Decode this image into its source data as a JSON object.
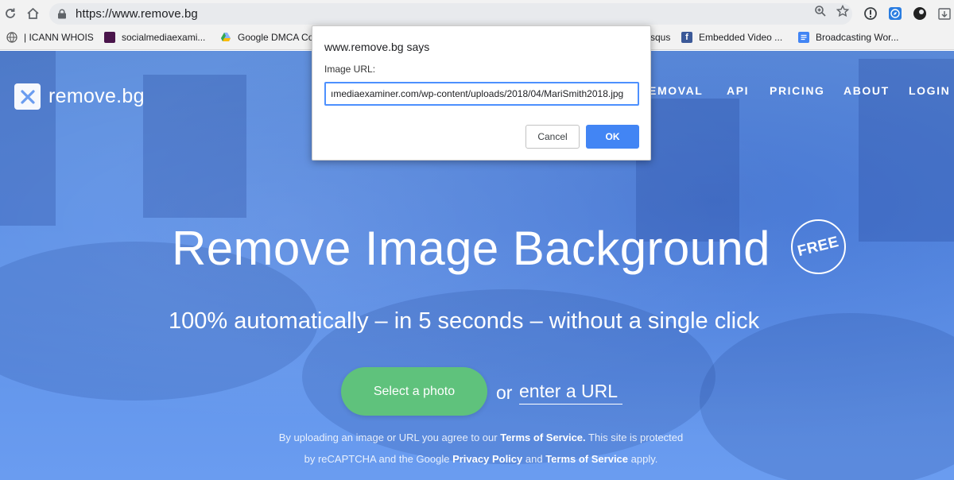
{
  "browser": {
    "url": "https://www.remove.bg",
    "bookmarks": [
      {
        "label": "| ICANN WHOIS",
        "icon": "globe-icon"
      },
      {
        "label": "socialmediaexami...",
        "icon": "slack-icon"
      },
      {
        "label": "Google DMCA Co",
        "icon": "drive-icon"
      },
      {
        "label": "squs",
        "icon": "disqus-icon"
      },
      {
        "label": "Embedded Video ...",
        "icon": "facebook-icon"
      },
      {
        "label": "Broadcasting Wor...",
        "icon": "docs-icon"
      }
    ]
  },
  "site": {
    "logo_text": "remove.bg",
    "nav": [
      "EMOVAL",
      "API",
      "PRICING",
      "ABOUT",
      "LOGIN"
    ],
    "hero_title": "Remove Image Background",
    "free_badge": "FREE",
    "subtitle": "100% automatically – in 5 seconds – without a single click",
    "select_button": "Select a photo",
    "or_text": "or",
    "url_link": "enter a URL",
    "legal": {
      "line1_pre": "By uploading an image or URL you agree to our",
      "terms": "Terms of Service.",
      "line1_post": "This site is protected",
      "line2_pre": "by reCAPTCHA and the Google",
      "privacy": "Privacy Policy",
      "and": "and",
      "terms2": "Terms of Service",
      "apply": "apply."
    }
  },
  "dialog": {
    "title": "www.remove.bg says",
    "label": "Image URL:",
    "input_value": "ımediaexaminer.com/wp-content/uploads/2018/04/MariSmith2018.jpg",
    "cancel": "Cancel",
    "ok": "OK"
  },
  "colors": {
    "accent_blue": "#4285f4",
    "page_blue": "#5b8fe6",
    "button_green": "#5fc27c"
  }
}
